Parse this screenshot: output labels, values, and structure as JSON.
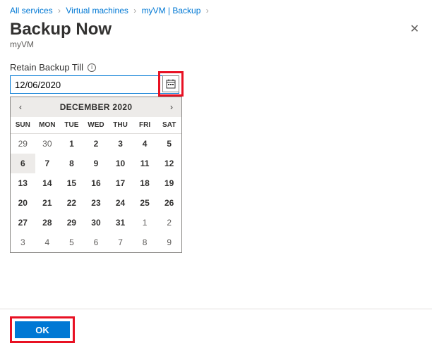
{
  "breadcrumb": {
    "items": [
      {
        "label": "All services"
      },
      {
        "label": "Virtual machines"
      },
      {
        "label": "myVM | Backup"
      }
    ],
    "sep": "›"
  },
  "header": {
    "title": "Backup Now",
    "subtitle": "myVM",
    "close": "✕"
  },
  "field": {
    "label": "Retain Backup Till",
    "info": "i",
    "value": "12/06/2020"
  },
  "calendar": {
    "title": "DECEMBER 2020",
    "prev": "‹",
    "next": "›",
    "dows": [
      "SUN",
      "MON",
      "TUE",
      "WED",
      "THU",
      "FRI",
      "SAT"
    ],
    "weeks": [
      [
        {
          "d": "29",
          "muted": true
        },
        {
          "d": "30",
          "muted": true
        },
        {
          "d": "1"
        },
        {
          "d": "2"
        },
        {
          "d": "3"
        },
        {
          "d": "4"
        },
        {
          "d": "5"
        }
      ],
      [
        {
          "d": "6",
          "selected": true
        },
        {
          "d": "7"
        },
        {
          "d": "8"
        },
        {
          "d": "9"
        },
        {
          "d": "10"
        },
        {
          "d": "11"
        },
        {
          "d": "12"
        }
      ],
      [
        {
          "d": "13"
        },
        {
          "d": "14"
        },
        {
          "d": "15"
        },
        {
          "d": "16"
        },
        {
          "d": "17"
        },
        {
          "d": "18"
        },
        {
          "d": "19"
        }
      ],
      [
        {
          "d": "20"
        },
        {
          "d": "21"
        },
        {
          "d": "22"
        },
        {
          "d": "23"
        },
        {
          "d": "24"
        },
        {
          "d": "25"
        },
        {
          "d": "26"
        }
      ],
      [
        {
          "d": "27"
        },
        {
          "d": "28"
        },
        {
          "d": "29"
        },
        {
          "d": "30"
        },
        {
          "d": "31"
        },
        {
          "d": "1",
          "muted": true
        },
        {
          "d": "2",
          "muted": true
        }
      ],
      [
        {
          "d": "3",
          "muted": true
        },
        {
          "d": "4",
          "muted": true
        },
        {
          "d": "5",
          "muted": true
        },
        {
          "d": "6",
          "muted": true
        },
        {
          "d": "7",
          "muted": true
        },
        {
          "d": "8",
          "muted": true
        },
        {
          "d": "9",
          "muted": true
        }
      ]
    ]
  },
  "footer": {
    "ok": "OK"
  }
}
